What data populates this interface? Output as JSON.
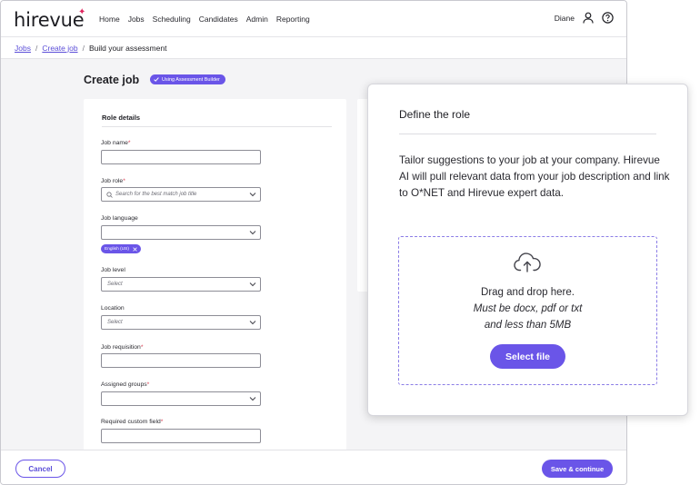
{
  "brand": {
    "logo_text": "hirevue",
    "accent": "#6a55e8",
    "star_color": "#e0245e"
  },
  "nav": {
    "links": [
      "Home",
      "Jobs",
      "Scheduling",
      "Candidates",
      "Admin",
      "Reporting"
    ],
    "user_name": "Diane"
  },
  "breadcrumb": {
    "items": [
      "Jobs",
      "Create job",
      "Build your assessment"
    ],
    "separator": "/"
  },
  "page": {
    "title": "Create job",
    "badge": "Using Assessment Builder"
  },
  "form": {
    "section_title": "Role details",
    "fields": {
      "job_name": {
        "label": "Job name"
      },
      "job_role": {
        "label": "Job role",
        "placeholder": "Search for the best match job title"
      },
      "job_language": {
        "label": "Job language",
        "chip": "English (US)"
      },
      "job_level": {
        "label": "Job level",
        "placeholder": "Select"
      },
      "location": {
        "label": "Location",
        "placeholder": "Select"
      },
      "job_requisition": {
        "label": "Job requisition"
      },
      "assigned_groups": {
        "label": "Assigned groups"
      },
      "required_custom_field": {
        "label": "Required custom field"
      }
    },
    "required_mark": "*"
  },
  "footer": {
    "cancel_label": "Cancel",
    "save_label": "Save & continue"
  },
  "define_role": {
    "title": "Define the role",
    "description": "Tailor suggestions to your job at your company. Hirevue AI will pull relevant data from your job description and link to O*NET and Hirevue expert data.",
    "drop_line1": "Drag and drop here.",
    "drop_line2": "Must be docx, pdf or txt",
    "drop_line3": "and less than 5MB",
    "select_label": "Select file"
  }
}
